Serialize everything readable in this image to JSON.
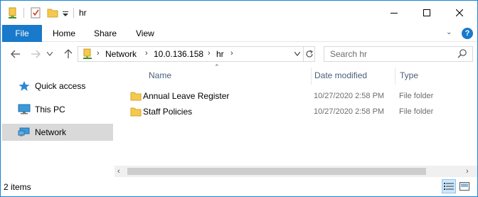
{
  "window": {
    "title": "hr",
    "colors": {
      "accent": "#1979ca",
      "border": "#1883d7",
      "folder": "#f5c94d",
      "selected": "#d9d9d9"
    }
  },
  "quick_access_toolbar": {
    "icons": [
      "properties-icon",
      "checkmark-icon",
      "new-folder-icon",
      "customize-dropdown-icon"
    ]
  },
  "ribbon": {
    "file_label": "File",
    "tabs": [
      "Home",
      "Share",
      "View"
    ]
  },
  "address": {
    "crumbs": [
      "Network",
      "10.0.136.158",
      "hr"
    ]
  },
  "search": {
    "placeholder": "Search hr"
  },
  "sidebar": {
    "items": [
      {
        "label": "Quick access",
        "icon": "star-icon"
      },
      {
        "label": "This PC",
        "icon": "monitor-icon"
      },
      {
        "label": "Network",
        "icon": "network-icon",
        "selected": true
      }
    ]
  },
  "columns": {
    "name": "Name",
    "date": "Date modified",
    "type": "Type"
  },
  "files": [
    {
      "name": "Annual Leave Register",
      "date": "10/27/2020 2:58 PM",
      "type": "File folder"
    },
    {
      "name": "Staff Policies",
      "date": "10/27/2020 2:58 PM",
      "type": "File folder"
    }
  ],
  "status": {
    "item_count": "2 items"
  }
}
